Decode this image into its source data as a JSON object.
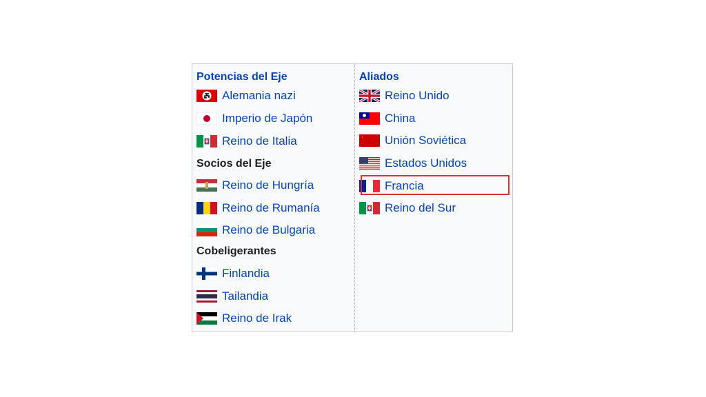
{
  "axis_group": {
    "heading": "Potencias del Eje",
    "items": [
      {
        "label": "Alemania nazi",
        "flag": "nazi-germany-flag-icon"
      },
      {
        "label": "Imperio de Japón",
        "flag": "japan-flag-icon"
      },
      {
        "label": "Reino de Italia",
        "flag": "italy-flag-icon"
      }
    ]
  },
  "axis_partners": {
    "heading": "Socios del Eje",
    "items": [
      {
        "label": "Reino de Hungría",
        "flag": "hungary-flag-icon"
      },
      {
        "label": "Reino de Rumanía",
        "flag": "romania-flag-icon"
      },
      {
        "label": "Reino de Bulgaria",
        "flag": "bulgaria-flag-icon"
      }
    ]
  },
  "co_belligerents": {
    "heading": "Cobeligerantes",
    "items": [
      {
        "label": "Finlandia",
        "flag": "finland-flag-icon"
      },
      {
        "label": "Tailandia",
        "flag": "thailand-flag-icon"
      },
      {
        "label": "Reino de Irak",
        "flag": "iraq-flag-icon"
      }
    ]
  },
  "allies": {
    "heading": "Aliados",
    "items": [
      {
        "label": "Reino Unido",
        "flag": "uk-flag-icon"
      },
      {
        "label": "China",
        "flag": "china-roc-flag-icon"
      },
      {
        "label": "Unión Soviética",
        "flag": "soviet-union-flag-icon"
      },
      {
        "label": "Estados Unidos",
        "flag": "usa-flag-icon"
      },
      {
        "label": "Francia",
        "flag": "france-flag-icon",
        "highlighted": true
      },
      {
        "label": "Reino del Sur",
        "flag": "italy-south-flag-icon"
      }
    ]
  },
  "colors": {
    "link": "#0645ad",
    "text": "#202122",
    "box_background": "#f8f9fa",
    "box_border": "#c8ccd1",
    "highlight_border": "#e03131"
  }
}
